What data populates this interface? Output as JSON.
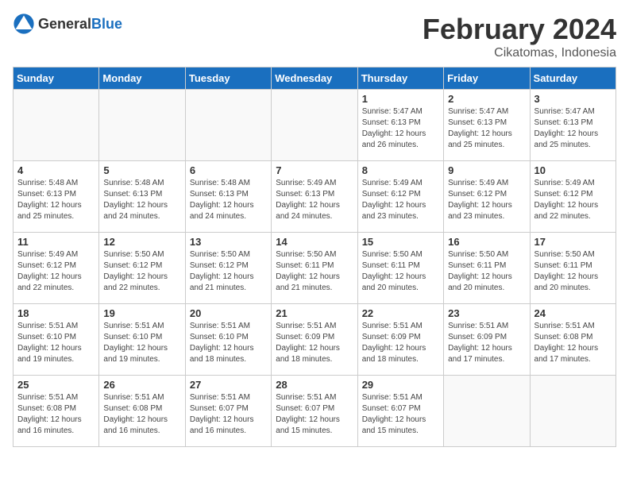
{
  "header": {
    "logo_general": "General",
    "logo_blue": "Blue",
    "month_year": "February 2024",
    "location": "Cikatomas, Indonesia"
  },
  "days_of_week": [
    "Sunday",
    "Monday",
    "Tuesday",
    "Wednesday",
    "Thursday",
    "Friday",
    "Saturday"
  ],
  "weeks": [
    [
      {
        "day": "",
        "info": ""
      },
      {
        "day": "",
        "info": ""
      },
      {
        "day": "",
        "info": ""
      },
      {
        "day": "",
        "info": ""
      },
      {
        "day": "1",
        "info": "Sunrise: 5:47 AM\nSunset: 6:13 PM\nDaylight: 12 hours\nand 26 minutes."
      },
      {
        "day": "2",
        "info": "Sunrise: 5:47 AM\nSunset: 6:13 PM\nDaylight: 12 hours\nand 25 minutes."
      },
      {
        "day": "3",
        "info": "Sunrise: 5:47 AM\nSunset: 6:13 PM\nDaylight: 12 hours\nand 25 minutes."
      }
    ],
    [
      {
        "day": "4",
        "info": "Sunrise: 5:48 AM\nSunset: 6:13 PM\nDaylight: 12 hours\nand 25 minutes."
      },
      {
        "day": "5",
        "info": "Sunrise: 5:48 AM\nSunset: 6:13 PM\nDaylight: 12 hours\nand 24 minutes."
      },
      {
        "day": "6",
        "info": "Sunrise: 5:48 AM\nSunset: 6:13 PM\nDaylight: 12 hours\nand 24 minutes."
      },
      {
        "day": "7",
        "info": "Sunrise: 5:49 AM\nSunset: 6:13 PM\nDaylight: 12 hours\nand 24 minutes."
      },
      {
        "day": "8",
        "info": "Sunrise: 5:49 AM\nSunset: 6:12 PM\nDaylight: 12 hours\nand 23 minutes."
      },
      {
        "day": "9",
        "info": "Sunrise: 5:49 AM\nSunset: 6:12 PM\nDaylight: 12 hours\nand 23 minutes."
      },
      {
        "day": "10",
        "info": "Sunrise: 5:49 AM\nSunset: 6:12 PM\nDaylight: 12 hours\nand 22 minutes."
      }
    ],
    [
      {
        "day": "11",
        "info": "Sunrise: 5:49 AM\nSunset: 6:12 PM\nDaylight: 12 hours\nand 22 minutes."
      },
      {
        "day": "12",
        "info": "Sunrise: 5:50 AM\nSunset: 6:12 PM\nDaylight: 12 hours\nand 22 minutes."
      },
      {
        "day": "13",
        "info": "Sunrise: 5:50 AM\nSunset: 6:12 PM\nDaylight: 12 hours\nand 21 minutes."
      },
      {
        "day": "14",
        "info": "Sunrise: 5:50 AM\nSunset: 6:11 PM\nDaylight: 12 hours\nand 21 minutes."
      },
      {
        "day": "15",
        "info": "Sunrise: 5:50 AM\nSunset: 6:11 PM\nDaylight: 12 hours\nand 20 minutes."
      },
      {
        "day": "16",
        "info": "Sunrise: 5:50 AM\nSunset: 6:11 PM\nDaylight: 12 hours\nand 20 minutes."
      },
      {
        "day": "17",
        "info": "Sunrise: 5:50 AM\nSunset: 6:11 PM\nDaylight: 12 hours\nand 20 minutes."
      }
    ],
    [
      {
        "day": "18",
        "info": "Sunrise: 5:51 AM\nSunset: 6:10 PM\nDaylight: 12 hours\nand 19 minutes."
      },
      {
        "day": "19",
        "info": "Sunrise: 5:51 AM\nSunset: 6:10 PM\nDaylight: 12 hours\nand 19 minutes."
      },
      {
        "day": "20",
        "info": "Sunrise: 5:51 AM\nSunset: 6:10 PM\nDaylight: 12 hours\nand 18 minutes."
      },
      {
        "day": "21",
        "info": "Sunrise: 5:51 AM\nSunset: 6:09 PM\nDaylight: 12 hours\nand 18 minutes."
      },
      {
        "day": "22",
        "info": "Sunrise: 5:51 AM\nSunset: 6:09 PM\nDaylight: 12 hours\nand 18 minutes."
      },
      {
        "day": "23",
        "info": "Sunrise: 5:51 AM\nSunset: 6:09 PM\nDaylight: 12 hours\nand 17 minutes."
      },
      {
        "day": "24",
        "info": "Sunrise: 5:51 AM\nSunset: 6:08 PM\nDaylight: 12 hours\nand 17 minutes."
      }
    ],
    [
      {
        "day": "25",
        "info": "Sunrise: 5:51 AM\nSunset: 6:08 PM\nDaylight: 12 hours\nand 16 minutes."
      },
      {
        "day": "26",
        "info": "Sunrise: 5:51 AM\nSunset: 6:08 PM\nDaylight: 12 hours\nand 16 minutes."
      },
      {
        "day": "27",
        "info": "Sunrise: 5:51 AM\nSunset: 6:07 PM\nDaylight: 12 hours\nand 16 minutes."
      },
      {
        "day": "28",
        "info": "Sunrise: 5:51 AM\nSunset: 6:07 PM\nDaylight: 12 hours\nand 15 minutes."
      },
      {
        "day": "29",
        "info": "Sunrise: 5:51 AM\nSunset: 6:07 PM\nDaylight: 12 hours\nand 15 minutes."
      },
      {
        "day": "",
        "info": ""
      },
      {
        "day": "",
        "info": ""
      }
    ]
  ]
}
